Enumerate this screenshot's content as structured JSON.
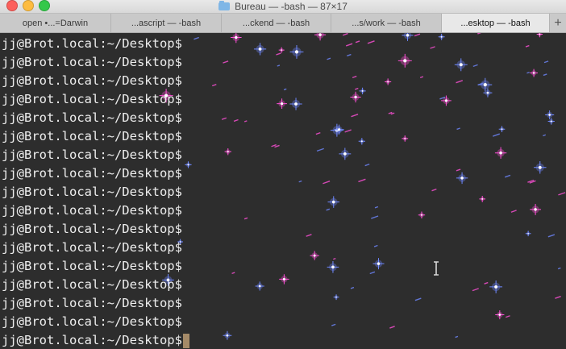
{
  "window": {
    "title": "Bureau — -bash — 87×17",
    "colors": {
      "background": "#2d2d2d",
      "text": "#eeeeee",
      "cursor": "#a58a68",
      "star_blue": "#6f88ff",
      "star_pink": "#ff4fd8"
    }
  },
  "tabs": [
    {
      "label": "open •...=Darwin",
      "active": false
    },
    {
      "label": "...ascript — -bash",
      "active": false
    },
    {
      "label": "...ckend — -bash",
      "active": false
    },
    {
      "label": "...s/work — -bash",
      "active": false
    },
    {
      "label": "...esktop — -bash",
      "active": true
    }
  ],
  "new_tab_label": "+",
  "terminal": {
    "prompt_lines": [
      "jj@Brot.local:~/Desktop$",
      "jj@Brot.local:~/Desktop$",
      "jj@Brot.local:~/Desktop$",
      "jj@Brot.local:~/Desktop$",
      "jj@Brot.local:~/Desktop$",
      "jj@Brot.local:~/Desktop$",
      "jj@Brot.local:~/Desktop$",
      "jj@Brot.local:~/Desktop$",
      "jj@Brot.local:~/Desktop$",
      "jj@Brot.local:~/Desktop$",
      "jj@Brot.local:~/Desktop$",
      "jj@Brot.local:~/Desktop$",
      "jj@Brot.local:~/Desktop$",
      "jj@Brot.local:~/Desktop$",
      "jj@Brot.local:~/Desktop$",
      "jj@Brot.local:~/Desktop$",
      "jj@Brot.local:~/Desktop$"
    ]
  }
}
